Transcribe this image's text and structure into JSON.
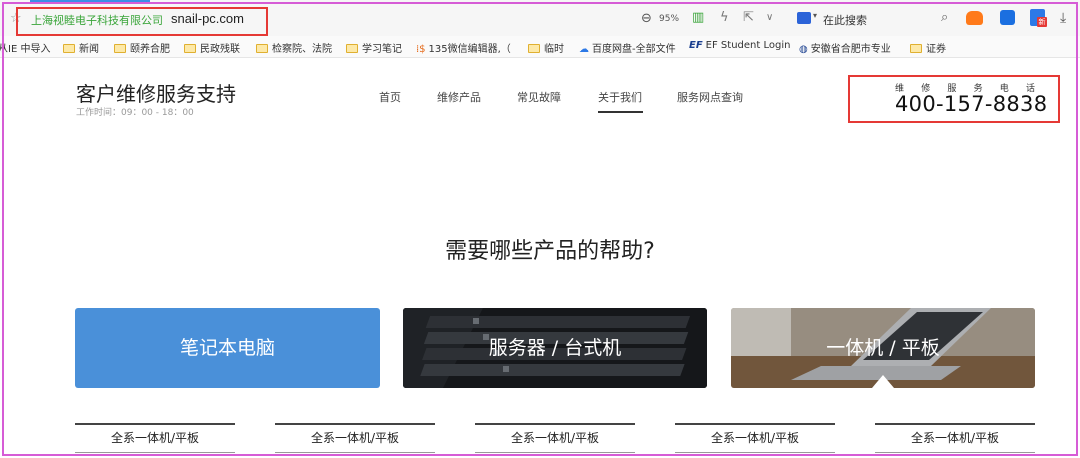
{
  "browser": {
    "site_name": "上海视睦电子科技有限公司",
    "domain": "snail-pc.com",
    "zoom": "95%",
    "search_label": "在此搜索",
    "app_badge": "新"
  },
  "bookmarks": [
    {
      "label": "从IE 中导入"
    },
    {
      "label": "新闻"
    },
    {
      "label": "颐养合肥"
    },
    {
      "label": "民政残联"
    },
    {
      "label": "检察院、法院"
    },
    {
      "label": "学习笔记"
    },
    {
      "label": "135微信编辑器,（"
    },
    {
      "label": "临时"
    },
    {
      "label": "百度网盘-全部文件"
    },
    {
      "label": "EF Student Login"
    },
    {
      "label": "安徽省合肥市专业"
    },
    {
      "label": "证券"
    }
  ],
  "site": {
    "title": "客户维修服务支持",
    "work_hours": "工作时间：09：00 - 18：00",
    "nav": [
      "首页",
      "维修产品",
      "常见故障",
      "关于我们",
      "服务网点查询"
    ],
    "phone_label": "维修服务电话",
    "phone_number": "400-157-8838"
  },
  "main": {
    "heading": "需要哪些产品的帮助?",
    "cards": [
      {
        "label": "笔记本电脑"
      },
      {
        "label": "服务器 / 台式机"
      },
      {
        "label": "一体机 / 平板"
      }
    ],
    "subtabs": [
      "全系一体机/平板",
      "全系一体机/平板",
      "全系一体机/平板",
      "全系一体机/平板",
      "全系一体机/平板"
    ]
  },
  "colors": {
    "frame": "#d65cd6",
    "highlight": "#e53935",
    "card_blue": "#4a90d9",
    "site_name_green": "#3aa53a"
  }
}
